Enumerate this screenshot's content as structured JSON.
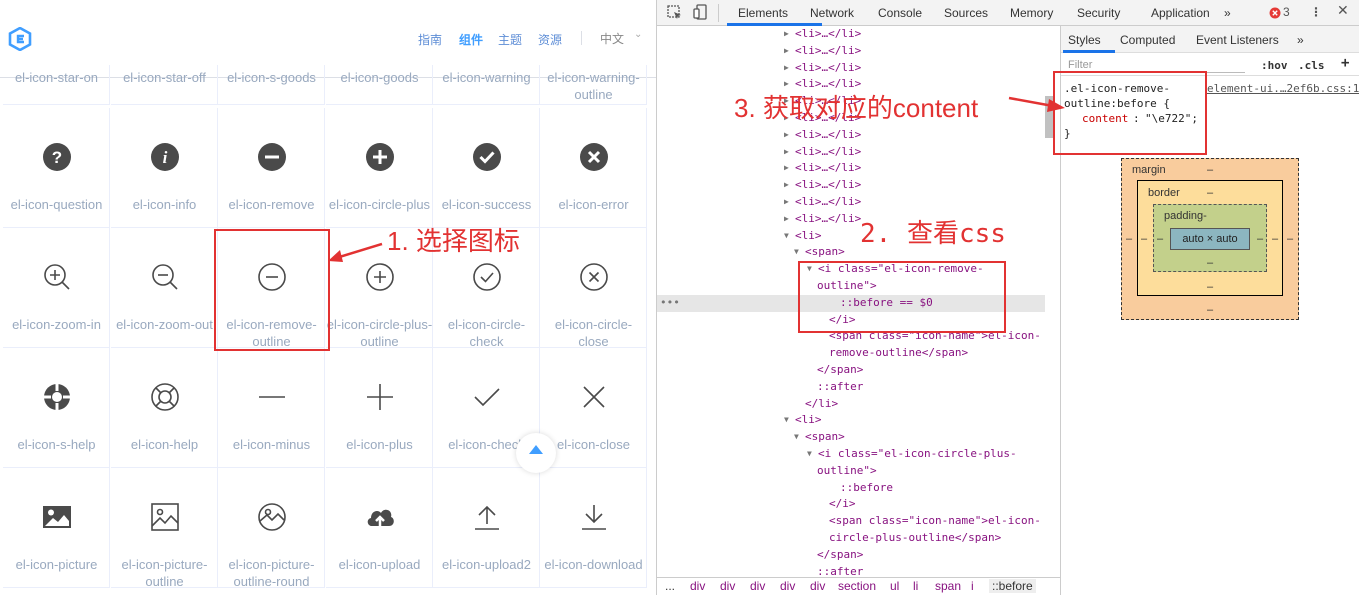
{
  "site": {
    "nav": [
      "指南",
      "组件",
      "主题",
      "资源"
    ],
    "active_nav": "组件",
    "lang": "中文",
    "lang_arrow": "⌄"
  },
  "icons": {
    "top_row": [
      "el-icon-star-on",
      "el-icon-star-off",
      "el-icon-s-goods",
      "el-icon-goods",
      "el-icon-warning",
      "el-icon-warning-outline"
    ],
    "rows": [
      [
        "el-icon-question",
        "el-icon-info",
        "el-icon-remove",
        "el-icon-circle-plus",
        "el-icon-success",
        "el-icon-error"
      ],
      [
        "el-icon-zoom-in",
        "el-icon-zoom-out",
        "el-icon-remove-outline",
        "el-icon-circle-plus-outline",
        "el-icon-circle-check",
        "el-icon-circle-close"
      ],
      [
        "el-icon-s-help",
        "el-icon-help",
        "el-icon-minus",
        "el-icon-plus",
        "el-icon-check",
        "el-icon-close"
      ],
      [
        "el-icon-picture",
        "el-icon-picture-outline",
        "el-icon-picture-outline-round",
        "el-icon-upload",
        "el-icon-upload2",
        "el-icon-download"
      ]
    ]
  },
  "annotations": {
    "step1": "1. 选择图标",
    "step2": "2. 查看css",
    "step3": "3. 获取对应的content"
  },
  "devtools": {
    "tabs": [
      "Elements",
      "Network",
      "Console",
      "Sources",
      "Memory",
      "Security",
      "Application",
      "»"
    ],
    "active_tab": "Elements",
    "error_count": "3",
    "styles_tabs": [
      "Styles",
      "Computed",
      "Event Listeners",
      "»"
    ],
    "filter_placeholder": "Filter",
    "hov": ":hov",
    "cls": ".cls",
    "plus": "+",
    "more": "⋮",
    "rule": {
      "selector_line1": ".el-icon-remove-",
      "selector_line2": "outline:before {",
      "source": "element-ui.…2ef6b.css:1",
      "property": "content",
      "value": "\"\\e722\";",
      "close": "}"
    },
    "boxmodel": {
      "margin": "margin",
      "border": "border",
      "padding": "padding-",
      "content": "auto × auto",
      "dash": "–"
    },
    "dom": {
      "li_collapsed": "<li>…</li>",
      "li_open": "<li>",
      "li_close": "</li>",
      "span_open": "<span>",
      "span_close": "</span>",
      "i_open_1": "<i class=\"el-icon-remove-",
      "i_open_1b": "outline\">",
      "before_sel": "::before == $0",
      "i_close": "</i>",
      "span_name_1a": "<span class=\"icon-name\">el-icon-",
      "span_name_1b": "remove-outline</span>",
      "after": "::after",
      "i_open_2": "<i class=\"el-icon-circle-plus-",
      "i_open_2b": "outline\">",
      "before": "::before",
      "span_name_2a": "<span class=\"icon-name\">el-icon-",
      "span_name_2b": "circle-plus-outline</span>",
      "after_partial": "::after",
      "dots": "•••"
    },
    "breadcrumb": [
      "...",
      "div",
      "div",
      "div",
      "div",
      "div",
      "section",
      "ul",
      "li",
      "span",
      "i",
      "::before"
    ]
  }
}
